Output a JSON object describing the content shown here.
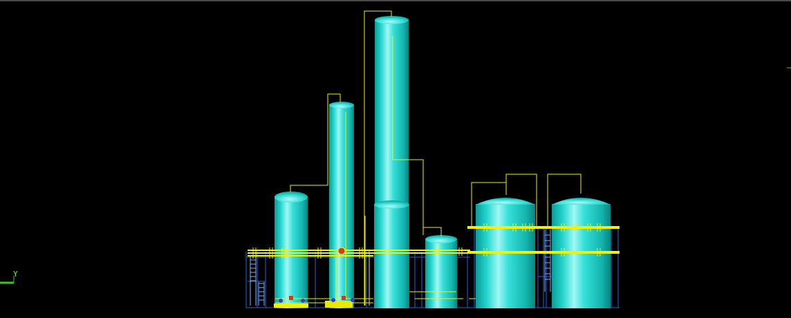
{
  "viewport": {
    "background": "#000000",
    "axis_label": "Y"
  },
  "colors": {
    "vessel": "#22d3cc",
    "vessel_highlight": "#b6fffb",
    "vessel_shadow": "#0a8f8a",
    "pipe": "#f2f200",
    "steel": "#2f5fd6",
    "valve_red": "#d23a1a",
    "axis": "#39c43a"
  },
  "icons": [
    "axis-triad-icon"
  ]
}
